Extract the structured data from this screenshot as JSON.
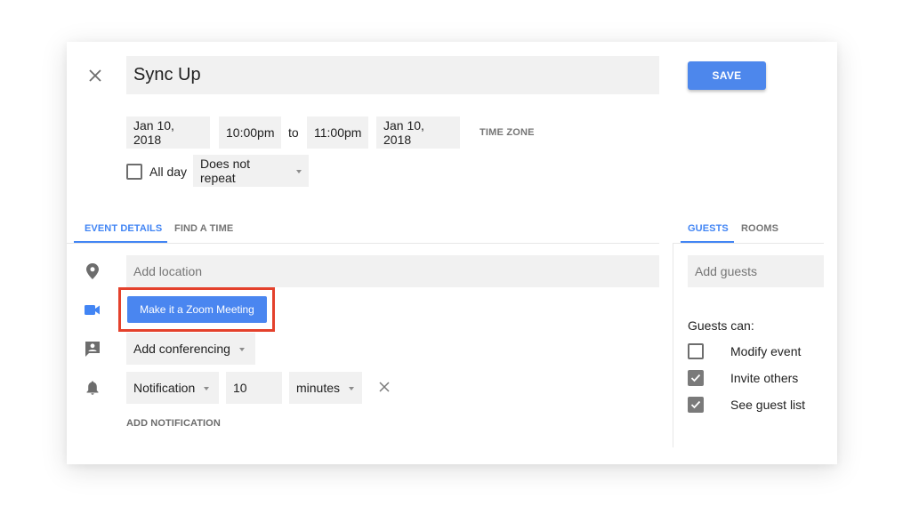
{
  "event": {
    "title": "Sync Up",
    "save_label": "SAVE"
  },
  "datetime": {
    "start_date": "Jan 10, 2018",
    "start_time": "10:00pm",
    "to_label": "to",
    "end_time": "11:00pm",
    "end_date": "Jan 10, 2018",
    "time_zone_label": "TIME ZONE",
    "all_day_label": "All day",
    "all_day_checked": false,
    "repeat_value": "Does not repeat"
  },
  "tabs": {
    "left": [
      {
        "label": "EVENT DETAILS",
        "active": true
      },
      {
        "label": "FIND A TIME",
        "active": false
      }
    ],
    "right": [
      {
        "label": "GUESTS",
        "active": true
      },
      {
        "label": "ROOMS",
        "active": false
      }
    ]
  },
  "details": {
    "location_placeholder": "Add location",
    "zoom_button_label": "Make it a Zoom Meeting",
    "conferencing_value": "Add conferencing",
    "notification": {
      "type": "Notification",
      "amount": "10",
      "unit": "minutes"
    },
    "add_notification_label": "ADD NOTIFICATION"
  },
  "guests": {
    "add_placeholder": "Add guests",
    "permissions_heading": "Guests can:",
    "permissions": [
      {
        "label": "Modify event",
        "checked": false
      },
      {
        "label": "Invite others",
        "checked": true
      },
      {
        "label": "See guest list",
        "checked": true
      }
    ]
  },
  "colors": {
    "accent": "#4285f4",
    "save_button": "#4d87ec",
    "zoom_button": "#4a86f0",
    "highlight_border": "#e4412c"
  }
}
